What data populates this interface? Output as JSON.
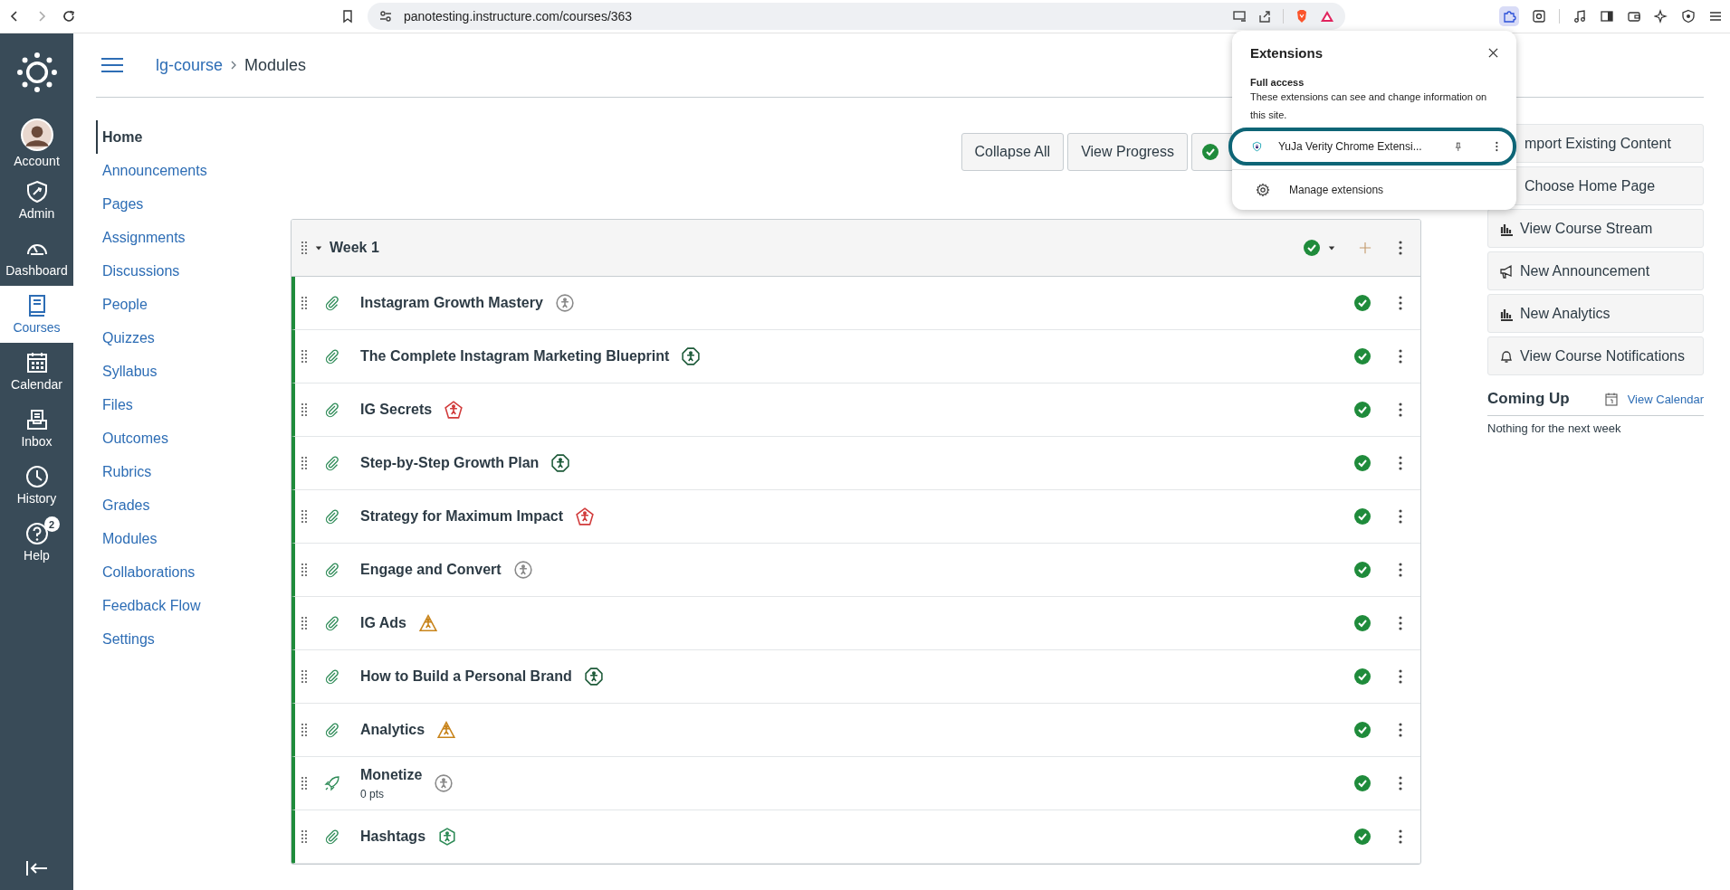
{
  "browser": {
    "url": "panotesting.instructure.com/courses/363"
  },
  "global_nav": [
    {
      "label": "Account",
      "selected": false
    },
    {
      "label": "Admin",
      "selected": false
    },
    {
      "label": "Dashboard",
      "selected": false
    },
    {
      "label": "Courses",
      "selected": true
    },
    {
      "label": "Calendar",
      "selected": false
    },
    {
      "label": "Inbox",
      "selected": false
    },
    {
      "label": "History",
      "selected": false
    },
    {
      "label": "Help",
      "badge": "2",
      "selected": false
    }
  ],
  "breadcrumb": [
    "lg-course",
    "Modules"
  ],
  "course_nav": [
    {
      "label": "Home",
      "selected": true
    },
    {
      "label": "Announcements",
      "selected": false
    },
    {
      "label": "Pages",
      "selected": false
    },
    {
      "label": "Assignments",
      "selected": false
    },
    {
      "label": "Discussions",
      "selected": false
    },
    {
      "label": "People",
      "selected": false
    },
    {
      "label": "Quizzes",
      "selected": false
    },
    {
      "label": "Syllabus",
      "selected": false
    },
    {
      "label": "Files",
      "selected": false
    },
    {
      "label": "Outcomes",
      "selected": false
    },
    {
      "label": "Rubrics",
      "selected": false
    },
    {
      "label": "Grades",
      "selected": false
    },
    {
      "label": "Modules",
      "selected": false
    },
    {
      "label": "Collaborations",
      "selected": false
    },
    {
      "label": "Feedback Flow",
      "selected": false
    },
    {
      "label": "Settings",
      "selected": false
    }
  ],
  "toolbar_buttons": [
    "Collapse All",
    "View Progress"
  ],
  "module": {
    "title": "Week 1",
    "expanded": true,
    "published": true,
    "items": [
      {
        "title": "Instagram Growth Mastery",
        "kind": "attachment",
        "published": true,
        "badge": {
          "kind": "circle",
          "color": "#8a8a8a"
        }
      },
      {
        "title": "The Complete Instagram Marketing Blueprint",
        "kind": "attachment",
        "published": true,
        "badge": {
          "kind": "octagon",
          "color": "#1d5a39"
        }
      },
      {
        "title": "IG Secrets",
        "kind": "attachment",
        "published": true,
        "badge": {
          "kind": "pentagon",
          "color": "#d13a3a"
        }
      },
      {
        "title": "Step-by-Step Growth Plan",
        "kind": "attachment",
        "published": true,
        "badge": {
          "kind": "octagon",
          "color": "#1d5a39"
        }
      },
      {
        "title": "Strategy for Maximum Impact",
        "kind": "attachment",
        "published": true,
        "badge": {
          "kind": "pentagon",
          "color": "#d13a3a"
        }
      },
      {
        "title": "Engage and Convert",
        "kind": "attachment",
        "published": true,
        "badge": {
          "kind": "circle",
          "color": "#8a8a8a"
        }
      },
      {
        "title": "IG Ads",
        "kind": "attachment",
        "published": true,
        "badge": {
          "kind": "triangle",
          "color": "#c8841b"
        }
      },
      {
        "title": "How to Build a Personal Brand",
        "kind": "attachment",
        "published": true,
        "badge": {
          "kind": "octagon",
          "color": "#1d5a39"
        }
      },
      {
        "title": "Analytics",
        "kind": "attachment",
        "published": true,
        "badge": {
          "kind": "triangle",
          "color": "#c8841b"
        }
      },
      {
        "title": "Monetize",
        "kind": "quiz",
        "points": "0 pts",
        "published": true,
        "badge": {
          "kind": "circle",
          "color": "#8a8a8a"
        }
      },
      {
        "title": "Hashtags",
        "kind": "attachment",
        "published": true,
        "badge": {
          "kind": "hexagon",
          "color": "#2e8b57"
        }
      }
    ]
  },
  "sidebar": {
    "buttons": [
      "mport Existing Content",
      "Choose Home Page",
      "View Course Stream",
      "New Announcement",
      "New Analytics",
      "View Course Notifications"
    ],
    "coming_up": {
      "title": "Coming Up",
      "link": "View Calendar",
      "empty": "Nothing for the next week"
    }
  },
  "extensions_popup": {
    "title": "Extensions",
    "section": "Full access",
    "description": "These extensions can see and change information on this site.",
    "extensions": [
      {
        "name": "YuJa Verity Chrome Extensi..."
      }
    ],
    "manage": "Manage extensions"
  }
}
